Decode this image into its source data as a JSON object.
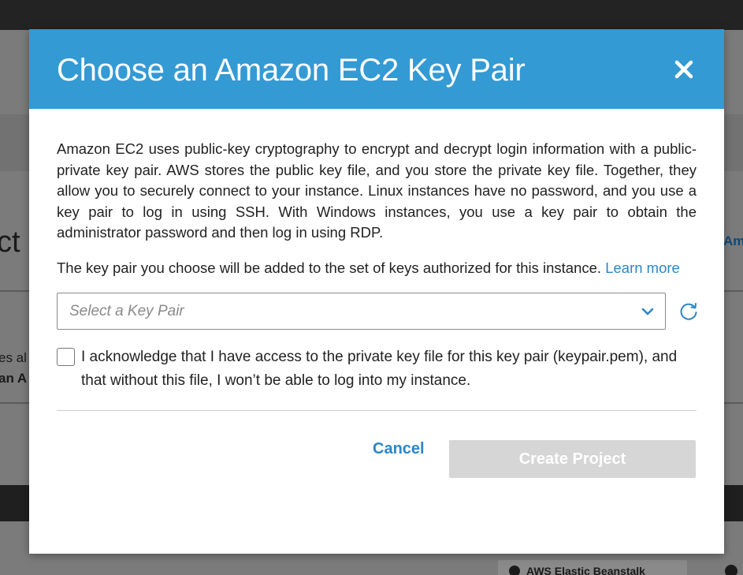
{
  "background": {
    "heading_fragment": "ct",
    "text_fragment_1": "es al",
    "text_fragment_2": "an A",
    "link_fragment": "Am",
    "chip_label": "AWS Elastic Beanstalk"
  },
  "modal": {
    "title": "Choose an Amazon EC2 Key Pair",
    "close_icon": "close-icon",
    "description": "Amazon EC2 uses public-key cryptography to encrypt and decrypt login information with a public-private key pair. AWS stores the public key file, and you store the private key file. Together, they allow you to securely connect to your instance. Linux instances have no password, and you use a key pair to log in using SSH. With Windows instances, you use a key pair to obtain the administrator password and then log in using RDP.",
    "authorization_text": "The key pair you choose will be added to the set of keys authorized for this instance.",
    "learn_more": "Learn more",
    "key_pair_select": {
      "placeholder": "Select a Key Pair",
      "chevron_icon": "chevron-down-icon",
      "refresh_icon": "refresh-icon"
    },
    "acknowledgement": {
      "checked": false,
      "text": "I acknowledge that I have access to the private key file for this key pair (keypair.pem), and that without this file, I won’t be able to log into my instance."
    },
    "footer": {
      "cancel_label": "Cancel",
      "create_label": "Create Project",
      "create_enabled": false
    }
  },
  "colors": {
    "header": "#339ad4",
    "link": "#2b86c8",
    "disabled_button": "#d6d6d6"
  }
}
